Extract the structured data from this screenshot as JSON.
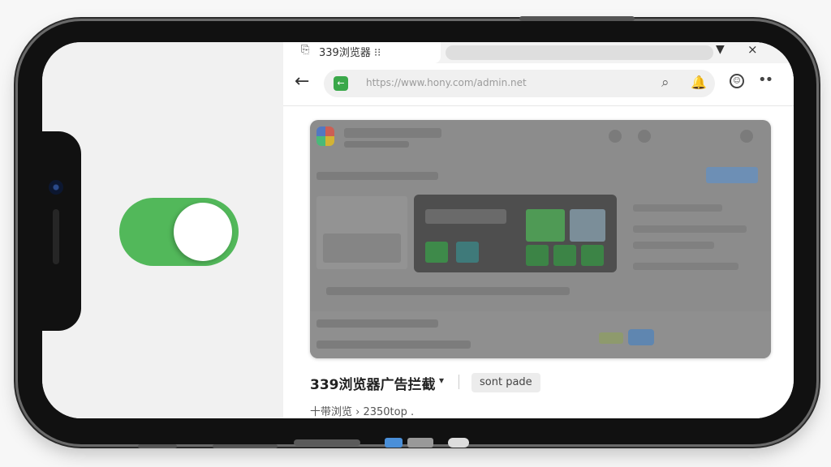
{
  "browser": {
    "tab": {
      "favicon": "tab-page-icon",
      "title": "339浏览器 ⁝⁝"
    },
    "tab_controls": {
      "dropdown": "▼",
      "close": "×"
    },
    "nav": {
      "back": "←",
      "url_secure_icon": "←",
      "url_text": "https://www.hony.com/admin.net",
      "search_icon": "⌕",
      "bell_icon": "🔔",
      "avatar_icon": "☺",
      "more_icon": "••"
    }
  },
  "page": {
    "title": "339浏览器广告拦截",
    "title_caret": "▾",
    "tag_chip": "sont pade",
    "meta": "十带浏览  ›  2350top  ."
  },
  "toggle": {
    "state": "on"
  },
  "colors": {
    "toggle_on": "#52b85a",
    "secure_badge": "#3aa84a",
    "phone_frame": "#111111"
  }
}
